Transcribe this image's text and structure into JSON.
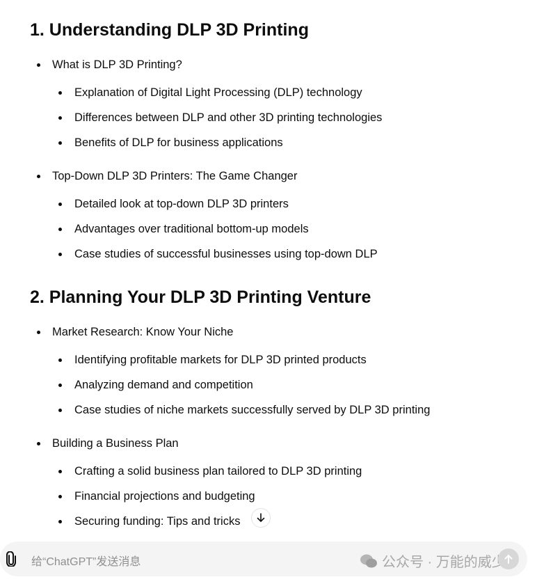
{
  "sections": [
    {
      "title": "1. Understanding DLP 3D Printing",
      "groups": [
        {
          "label": "What is DLP 3D Printing?",
          "items": [
            "Explanation of Digital Light Processing (DLP) technology",
            "Differences between DLP and other 3D printing technologies",
            "Benefits of DLP for business applications"
          ]
        },
        {
          "label": "Top-Down DLP 3D Printers: The Game Changer",
          "items": [
            "Detailed look at top-down DLP 3D printers",
            "Advantages over traditional bottom-up models",
            "Case studies of successful businesses using top-down DLP"
          ]
        }
      ]
    },
    {
      "title": "2. Planning Your DLP 3D Printing Venture",
      "groups": [
        {
          "label": "Market Research: Know Your Niche",
          "items": [
            "Identifying profitable markets for DLP 3D printed products",
            "Analyzing demand and competition",
            "Case studies of niche markets successfully served by DLP 3D printing"
          ]
        },
        {
          "label": "Building a Business Plan",
          "items": [
            "Crafting a solid business plan tailored to DLP 3D printing",
            "Financial projections and budgeting",
            "Securing funding: Tips and tricks"
          ]
        }
      ]
    }
  ],
  "composer": {
    "placeholder": "给“ChatGPT”发送消息",
    "attach_icon": "paperclip-icon",
    "send_icon": "arrow-up-icon"
  },
  "scroll_button": {
    "icon": "arrow-down-icon"
  },
  "watermark": "公众号 · 万能的威少"
}
